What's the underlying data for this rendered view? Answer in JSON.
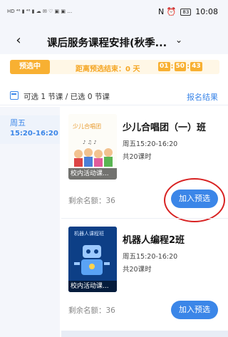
{
  "status_bar": {
    "left_glyphs": "HD ⁴⁶ ▮ ⁴⁶ ▮ ☁ ✉ ♡ ▣ ▣ …",
    "right_icons": "N ⏰",
    "battery": "83",
    "time": "10:08"
  },
  "nav": {
    "back_glyph": "‹",
    "title": "课后服务课程安排(秋季...",
    "chevron": "⌄"
  },
  "phase": {
    "tag": "预选中",
    "countdown_label": "距离预选结束：0 天",
    "hours": "01",
    "minutes": "50",
    "seconds": "43"
  },
  "selection": {
    "summary": "可选 1 节课 / 已选 0 节课",
    "results_link": "报名结果"
  },
  "days": [
    {
      "name": "周五",
      "time": "15:20-16:20"
    }
  ],
  "courses": [
    {
      "name": "少儿合唱团（一）班",
      "schedule": "周五15:20-16:20",
      "hours": "共20课时",
      "thumb_caption": "少儿合唱团",
      "thumb_tag": "校内活动课...",
      "remaining": "剩余名额：36",
      "button": "加入预选"
    },
    {
      "name": "机器人编程2班",
      "schedule": "周五15:20-16:20",
      "hours": "共20课时",
      "thumb_caption": "机器人课程班",
      "thumb_tag": "校内活动课...",
      "remaining": "剩余名额：36",
      "button": "加入预选"
    }
  ],
  "colors": {
    "accent": "#3b86e8",
    "phase": "#f8b032",
    "highlight": "#d82222"
  }
}
